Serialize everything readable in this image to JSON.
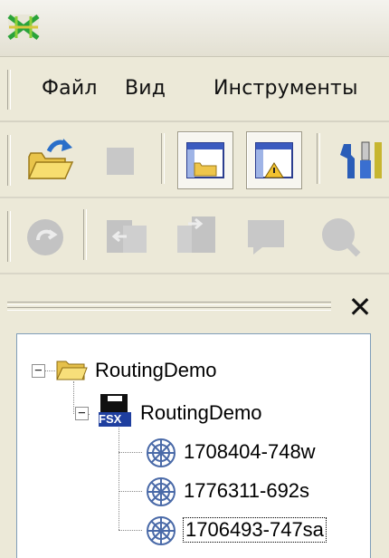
{
  "menu": {
    "file": "Файл",
    "view": "Вид",
    "tools": "Инструменты"
  },
  "tree": {
    "root": {
      "label": "RoutingDemo"
    },
    "child": {
      "label": "RoutingDemo",
      "badge": "FSX"
    },
    "items": [
      {
        "label": "1708404-748w"
      },
      {
        "label": "1776311-692s"
      },
      {
        "label": "1706493-747sa",
        "selected": true
      }
    ]
  },
  "panel": {
    "close_glyph": "✕"
  },
  "colors": {
    "background": "#ece9d8",
    "tree_border": "#7f9db9",
    "folder": "#f0d060"
  }
}
